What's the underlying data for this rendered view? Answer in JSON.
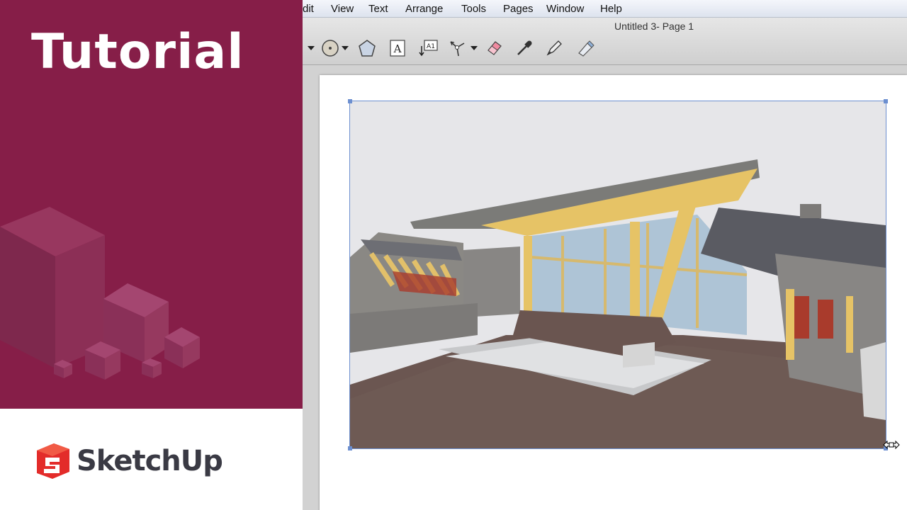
{
  "promo": {
    "title": "Tutorial",
    "brand_name": "SketchUp",
    "accent_color": "#861e48",
    "logo_color": "#e32c2a",
    "decoration": "isometric-cubes"
  },
  "app": {
    "window_title": "Untitled 3- Page 1",
    "menu": [
      "dit",
      "View",
      "Text",
      "Arrange",
      "Tools",
      "Pages",
      "Window",
      "Help"
    ],
    "toolbar_icons": [
      "dropdown-arrow-icon",
      "circle-shape-icon",
      "polygon-shape-icon",
      "text-tool-icon",
      "label-tool-icon",
      "dimension-tool-icon",
      "eraser-icon",
      "eyedropper-icon",
      "style-pen-icon",
      "split-tool-icon"
    ],
    "label_tool_text": "A1",
    "text_tool_text": "A"
  },
  "viewport": {
    "content": "sketchup-model-building",
    "selected": true,
    "cursor": "horizontal-resize-icon"
  }
}
